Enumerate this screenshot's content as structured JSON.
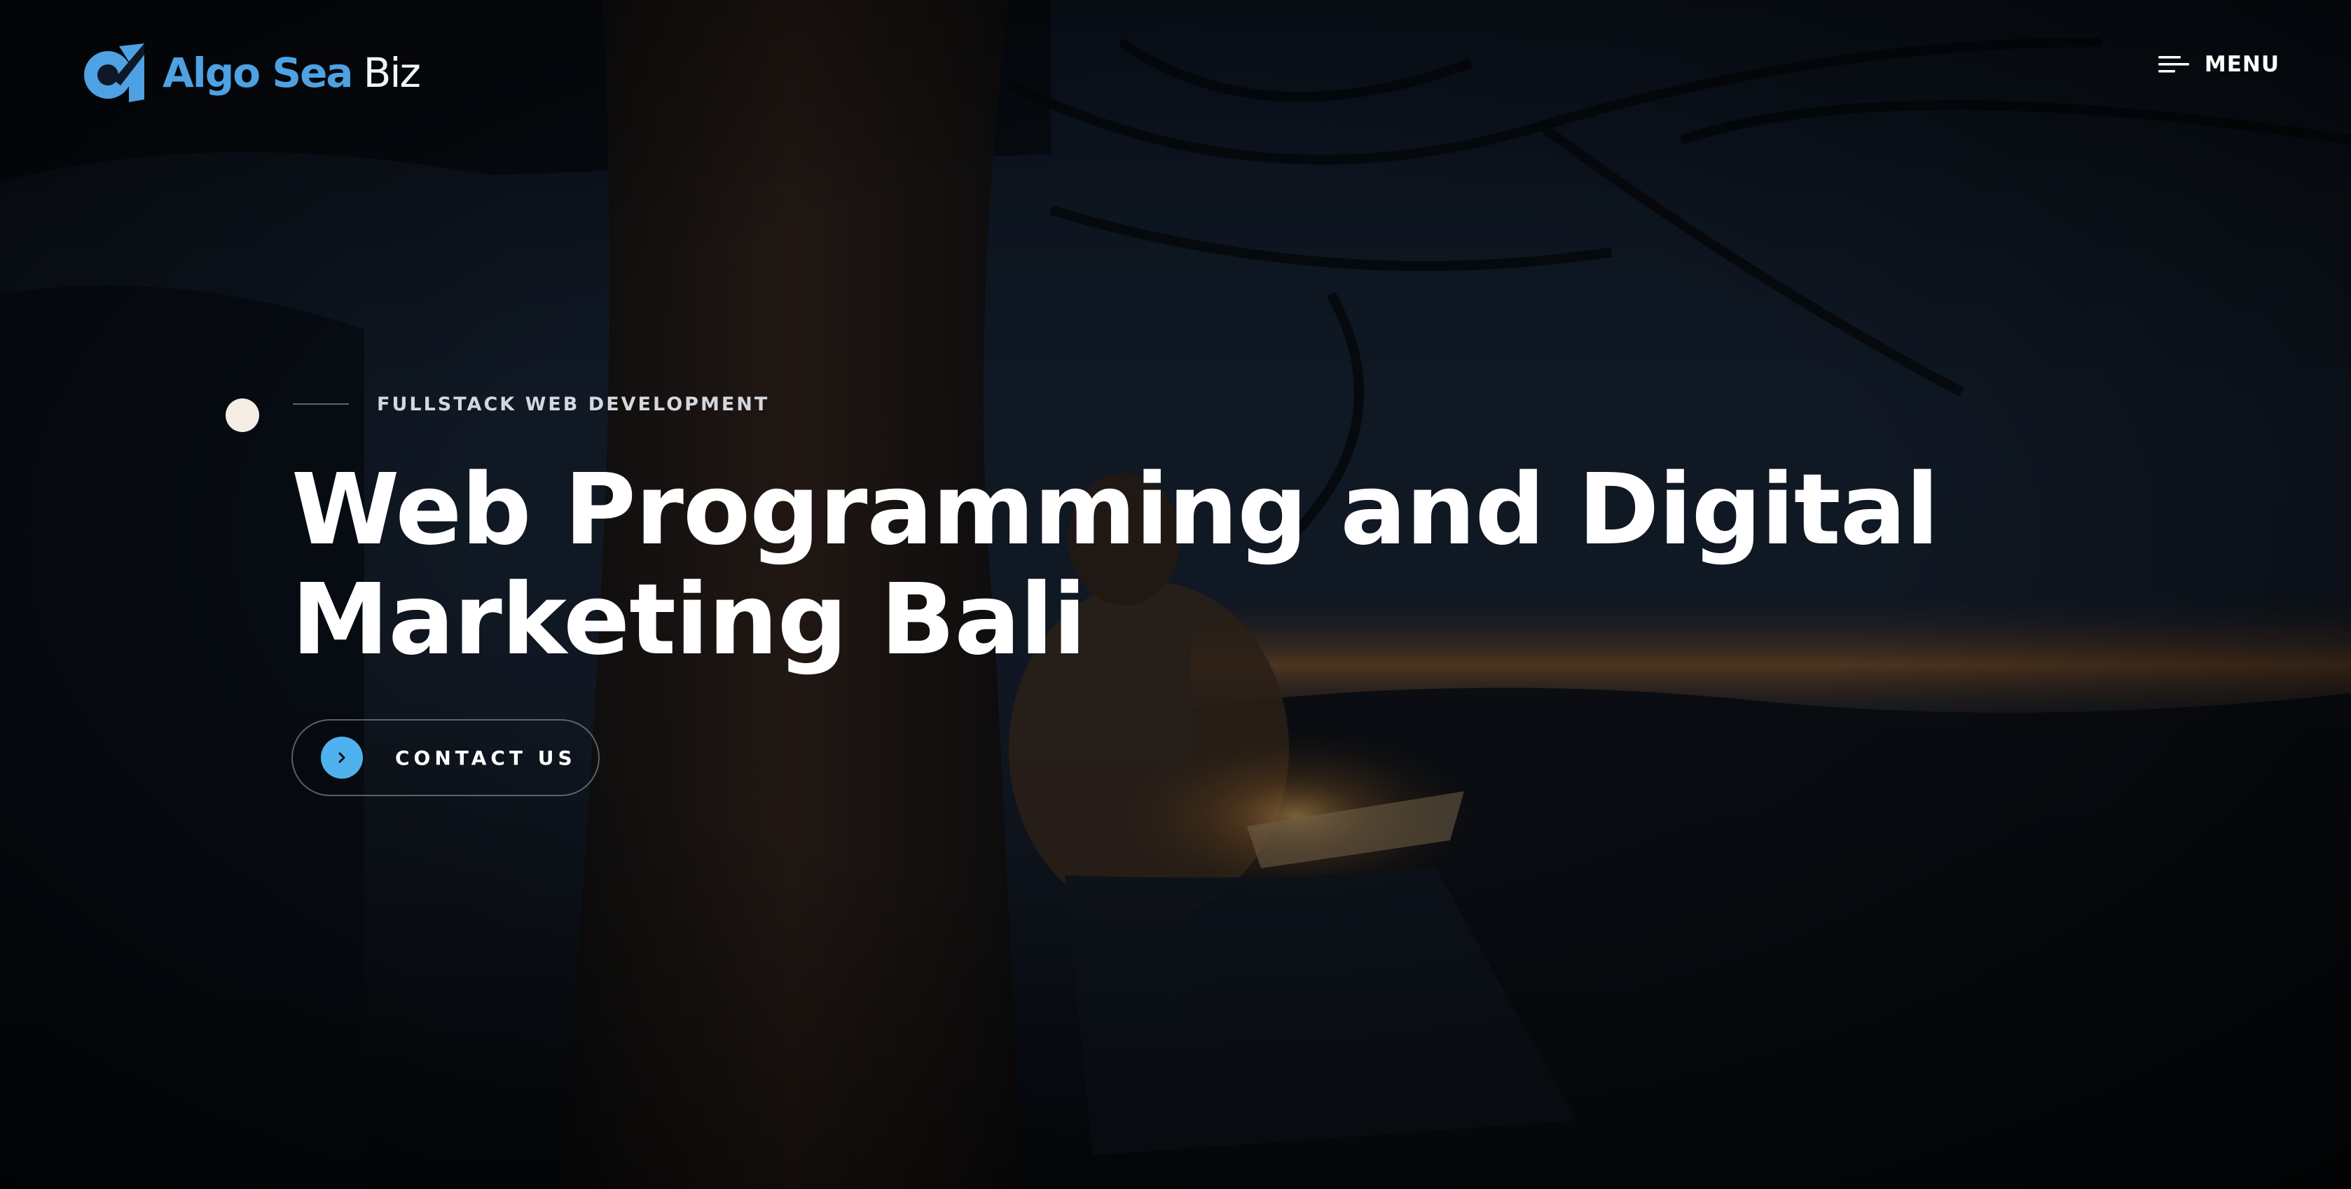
{
  "header": {
    "logo": {
      "name_part1": "Algo Sea",
      "name_part2": "Biz"
    },
    "menu": {
      "label": "MENU",
      "icon": "hamburger-menu-icon"
    }
  },
  "hero": {
    "eyebrow": "FULLSTACK WEB DEVELOPMENT",
    "title": "Web Programming and Digital Marketing Bali",
    "cta": {
      "label": "CONTACT US",
      "icon": "chevron-right-icon"
    },
    "background": "night photo of a person reading a glowing book under a tree"
  },
  "colors": {
    "brand_blue": "#4ea1e3",
    "cta_accent": "#4fb2ee",
    "dot": "#f5ede4",
    "text": "#ffffff"
  }
}
